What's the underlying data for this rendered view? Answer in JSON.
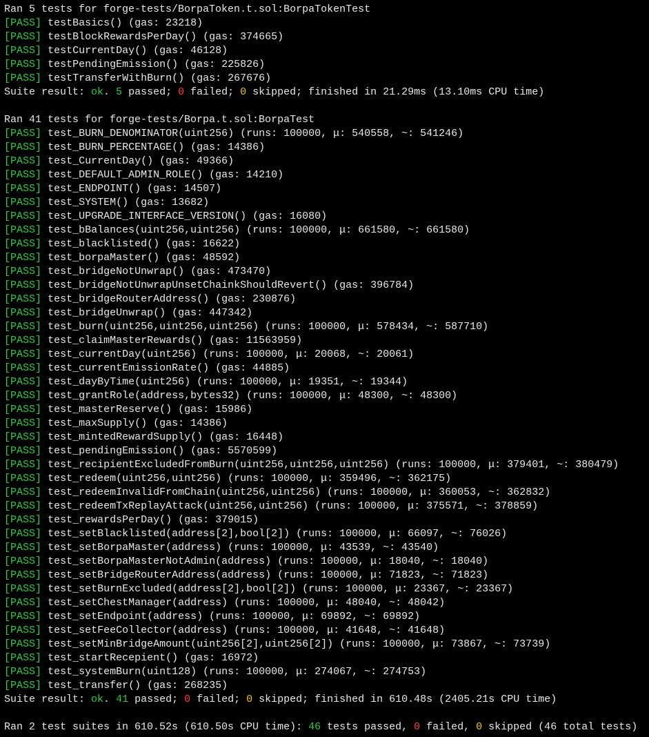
{
  "labels": {
    "pass": "PASS",
    "suite_result_prefix": "Suite result: ",
    "ok": "ok",
    "passed_word": "passed",
    "failed_word": "failed",
    "skipped_word": "skipped",
    "finished_in": "finished in",
    "cpu_time": "CPU time",
    "tests_passed": "tests passed",
    "total_tests": "total tests"
  },
  "suites": [
    {
      "header": "Ran 5 tests for forge-tests/BorpaToken.t.sol:BorpaTokenTest",
      "tests": [
        {
          "name": "testBasics()",
          "gas": "23218"
        },
        {
          "name": "testBlockRewardsPerDay()",
          "gas": "374665"
        },
        {
          "name": "testCurrentDay()",
          "gas": "46128"
        },
        {
          "name": "testPendingEmission()",
          "gas": "225826"
        },
        {
          "name": "testTransferWithBurn()",
          "gas": "267676"
        }
      ],
      "result": {
        "passed": "5",
        "failed": "0",
        "skipped": "0",
        "elapsed": "21.29ms",
        "cpu": "13.10ms"
      }
    },
    {
      "header": "Ran 41 tests for forge-tests/Borpa.t.sol:BorpaTest",
      "tests": [
        {
          "name": "test_BURN_DENOMINATOR(uint256)",
          "fuzz": {
            "runs": "100000",
            "mu": "540558",
            "tilde": "541246"
          }
        },
        {
          "name": "test_BURN_PERCENTAGE()",
          "gas": "14386"
        },
        {
          "name": "test_CurrentDay()",
          "gas": "49366"
        },
        {
          "name": "test_DEFAULT_ADMIN_ROLE()",
          "gas": "14210"
        },
        {
          "name": "test_ENDPOINT()",
          "gas": "14507"
        },
        {
          "name": "test_SYSTEM()",
          "gas": "13682"
        },
        {
          "name": "test_UPGRADE_INTERFACE_VERSION()",
          "gas": "16080"
        },
        {
          "name": "test_bBalances(uint256,uint256)",
          "fuzz": {
            "runs": "100000",
            "mu": "661580",
            "tilde": "661580"
          }
        },
        {
          "name": "test_blacklisted()",
          "gas": "16622"
        },
        {
          "name": "test_borpaMaster()",
          "gas": "48592"
        },
        {
          "name": "test_bridgeNotUnwrap()",
          "gas": "473470"
        },
        {
          "name": "test_bridgeNotUnwrapUnsetChainkShouldRevert()",
          "gas": "396784"
        },
        {
          "name": "test_bridgeRouterAddress()",
          "gas": "230876"
        },
        {
          "name": "test_bridgeUnwrap()",
          "gas": "447342"
        },
        {
          "name": "test_burn(uint256,uint256,uint256)",
          "fuzz": {
            "runs": "100000",
            "mu": "578434",
            "tilde": "587710"
          }
        },
        {
          "name": "test_claimMasterRewards()",
          "gas": "11563959"
        },
        {
          "name": "test_currentDay(uint256)",
          "fuzz": {
            "runs": "100000",
            "mu": "20068",
            "tilde": "20061"
          }
        },
        {
          "name": "test_currentEmissionRate()",
          "gas": "44885"
        },
        {
          "name": "test_dayByTime(uint256)",
          "fuzz": {
            "runs": "100000",
            "mu": "19351",
            "tilde": "19344"
          }
        },
        {
          "name": "test_grantRole(address,bytes32)",
          "fuzz": {
            "runs": "100000",
            "mu": "48300",
            "tilde": "48300"
          }
        },
        {
          "name": "test_masterReserve()",
          "gas": "15986"
        },
        {
          "name": "test_maxSupply()",
          "gas": "14386"
        },
        {
          "name": "test_mintedRewardSupply()",
          "gas": "16448"
        },
        {
          "name": "test_pendingEmission()",
          "gas": "5570599"
        },
        {
          "name": "test_recipientExcludedFromBurn(uint256,uint256,uint256)",
          "fuzz": {
            "runs": "100000",
            "mu": "379401",
            "tilde": "380479"
          }
        },
        {
          "name": "test_redeem(uint256,uint256)",
          "fuzz": {
            "runs": "100000",
            "mu": "359496",
            "tilde": "362175"
          }
        },
        {
          "name": "test_redeemInvalidFromChain(uint256,uint256)",
          "fuzz": {
            "runs": "100000",
            "mu": "360053",
            "tilde": "362832"
          }
        },
        {
          "name": "test_redeemTxReplayAttack(uint256,uint256)",
          "fuzz": {
            "runs": "100000",
            "mu": "375571",
            "tilde": "378859"
          }
        },
        {
          "name": "test_rewardsPerDay()",
          "gas": "379015"
        },
        {
          "name": "test_setBlacklisted(address[2],bool[2])",
          "fuzz": {
            "runs": "100000",
            "mu": "66097",
            "tilde": "76026"
          }
        },
        {
          "name": "test_setBorpaMaster(address)",
          "fuzz": {
            "runs": "100000",
            "mu": "43539",
            "tilde": "43540"
          }
        },
        {
          "name": "test_setBorpaMasterNotAdmin(address)",
          "fuzz": {
            "runs": "100000",
            "mu": "18040",
            "tilde": "18040"
          }
        },
        {
          "name": "test_setBridgeRouterAddress(address)",
          "fuzz": {
            "runs": "100000",
            "mu": "71823",
            "tilde": "71823"
          }
        },
        {
          "name": "test_setBurnExcluded(address[2],bool[2])",
          "fuzz": {
            "runs": "100000",
            "mu": "23367",
            "tilde": "23367"
          }
        },
        {
          "name": "test_setChestManager(address)",
          "fuzz": {
            "runs": "100000",
            "mu": "48040",
            "tilde": "48042"
          }
        },
        {
          "name": "test_setEndpoint(address)",
          "fuzz": {
            "runs": "100000",
            "mu": "69892",
            "tilde": "69892"
          }
        },
        {
          "name": "test_setFeeCollector(address)",
          "fuzz": {
            "runs": "100000",
            "mu": "41648",
            "tilde": "41648"
          }
        },
        {
          "name": "test_setMinBridgeAmount(uint256[2],uint256[2])",
          "fuzz": {
            "runs": "100000",
            "mu": "73867",
            "tilde": "73739"
          }
        },
        {
          "name": "test_startRecepient()",
          "gas": "16972"
        },
        {
          "name": "test_systemBurn(uint128)",
          "fuzz": {
            "runs": "100000",
            "mu": "274067",
            "tilde": "274753"
          }
        },
        {
          "name": "test_transfer()",
          "gas": "268235"
        }
      ],
      "result": {
        "passed": "41",
        "failed": "0",
        "skipped": "0",
        "elapsed": "610.48s",
        "cpu": "2405.21s"
      }
    }
  ],
  "final": {
    "suites": "2",
    "elapsed": "610.52s",
    "cpu": "610.50s",
    "passed": "46",
    "failed": "0",
    "skipped": "0",
    "total": "46"
  }
}
